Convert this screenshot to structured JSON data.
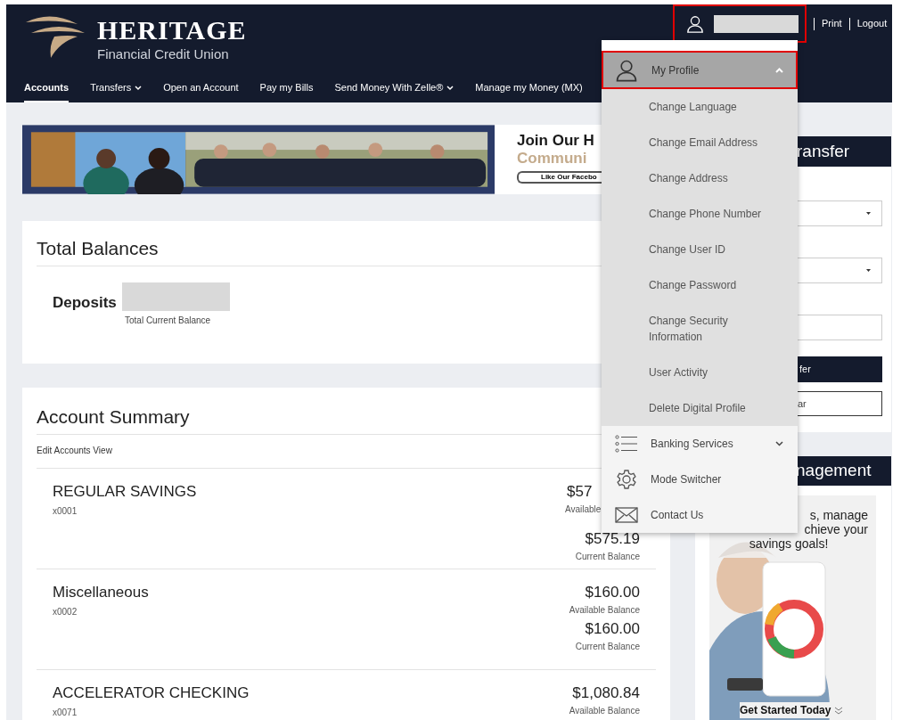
{
  "header": {
    "logo": {
      "name": "HERITAGE",
      "tagline": "Financial Credit Union"
    },
    "nav": [
      {
        "label": "Accounts",
        "selected": true,
        "has_menu": false
      },
      {
        "label": "Transfers",
        "selected": false,
        "has_menu": true
      },
      {
        "label": "Open an Account",
        "selected": false,
        "has_menu": false
      },
      {
        "label": "Pay my Bills",
        "selected": false,
        "has_menu": false
      },
      {
        "label": "Send Money With Zelle®",
        "selected": false,
        "has_menu": true
      },
      {
        "label": "Manage my Money (MX)",
        "selected": false,
        "has_menu": false
      }
    ],
    "links": [
      "Print",
      "Logout"
    ]
  },
  "banner": {
    "headline": "Join Our H",
    "subline": "Communi",
    "button": "Like Our Facebo"
  },
  "total_balances": {
    "title": "Total Balances",
    "label": "Deposits",
    "caption": "Total Current Balance"
  },
  "account_summary": {
    "title": "Account Summary",
    "edit_link": "Edit Accounts View",
    "accounts": [
      {
        "name": "REGULAR SAVINGS",
        "number": "x0001",
        "available": "$57",
        "available_label": "Available",
        "current": "$575.19",
        "current_label": "Current Balance",
        "covered": true
      },
      {
        "name": "Miscellaneous",
        "number": "x0002",
        "available": "$160.00",
        "available_label": "Available Balance",
        "current": "$160.00",
        "current_label": "Current Balance",
        "covered": false
      },
      {
        "name": "ACCELERATOR CHECKING",
        "number": "x0071",
        "available": "$1,080.84",
        "available_label": "Available Balance",
        "covered": false
      }
    ]
  },
  "transfer_panel": {
    "title": "ransfer",
    "fields": [
      {
        "kind": "select"
      },
      {
        "kind": "select"
      },
      {
        "kind": "input"
      }
    ],
    "primary_button": "fer",
    "secondary_button": "ar"
  },
  "money_panel": {
    "title": "nagement",
    "slogan": [
      "s, manage",
      "chieve your",
      "savings goals!"
    ],
    "cta": "Get Started Today"
  },
  "profile_menu": {
    "title": "My Profile",
    "expanded": true,
    "items": [
      "Change Language",
      "Change Email Address",
      "Change Address",
      "Change Phone Number",
      "Change User ID",
      "Change Password",
      "Change Security Information",
      "User Activity",
      "Delete Digital Profile"
    ],
    "more": [
      {
        "label": "Banking Services",
        "kind": "list",
        "has_menu": true
      },
      {
        "label": "Mode Switcher",
        "kind": "gear",
        "has_menu": false
      },
      {
        "label": "Contact Us",
        "kind": "mail",
        "has_menu": false
      }
    ]
  }
}
